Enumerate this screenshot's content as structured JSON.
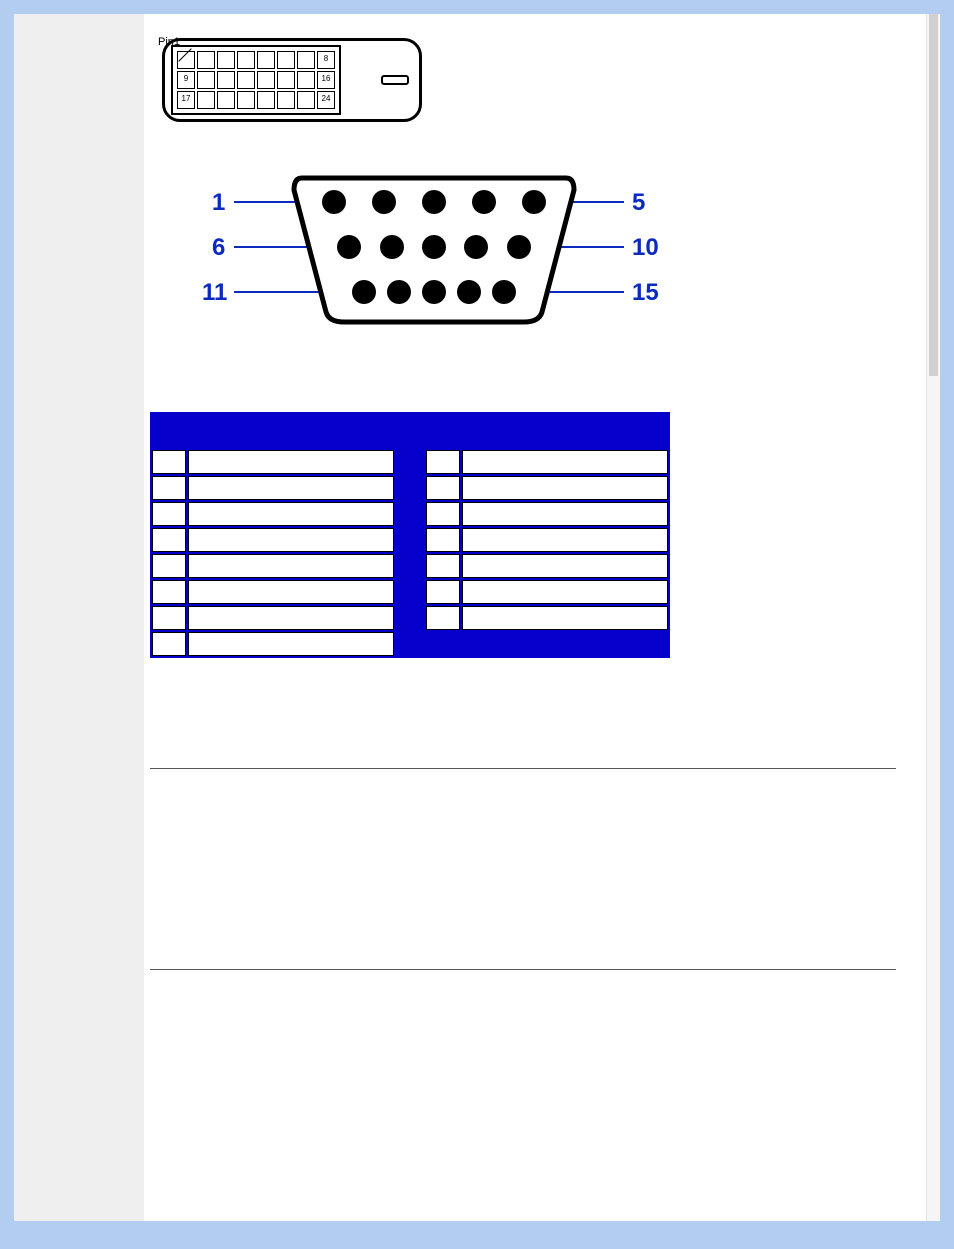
{
  "dvi": {
    "pin1_label": "Pin1",
    "visible_numbers": {
      "r1c8": "8",
      "r2c1": "9",
      "r2c8": "16",
      "r3c1": "17",
      "r3c8": "24"
    }
  },
  "vga": {
    "labels": {
      "top_left": "1",
      "top_right": "5",
      "mid_left": "6",
      "mid_right": "10",
      "bot_left": "11",
      "bot_right": "15"
    }
  },
  "pin_table": {
    "headers": {
      "pin": "",
      "assign": "",
      "pin2": "",
      "assign2": ""
    },
    "left_rows": [
      {
        "n": "",
        "v": ""
      },
      {
        "n": "",
        "v": ""
      },
      {
        "n": "",
        "v": ""
      },
      {
        "n": "",
        "v": ""
      },
      {
        "n": "",
        "v": ""
      },
      {
        "n": "",
        "v": ""
      },
      {
        "n": "",
        "v": ""
      },
      {
        "n": "",
        "v": ""
      }
    ],
    "right_rows": [
      {
        "n": "",
        "v": ""
      },
      {
        "n": "",
        "v": ""
      },
      {
        "n": "",
        "v": ""
      },
      {
        "n": "",
        "v": ""
      },
      {
        "n": "",
        "v": ""
      },
      {
        "n": "",
        "v": ""
      },
      {
        "n": "",
        "v": ""
      }
    ]
  }
}
